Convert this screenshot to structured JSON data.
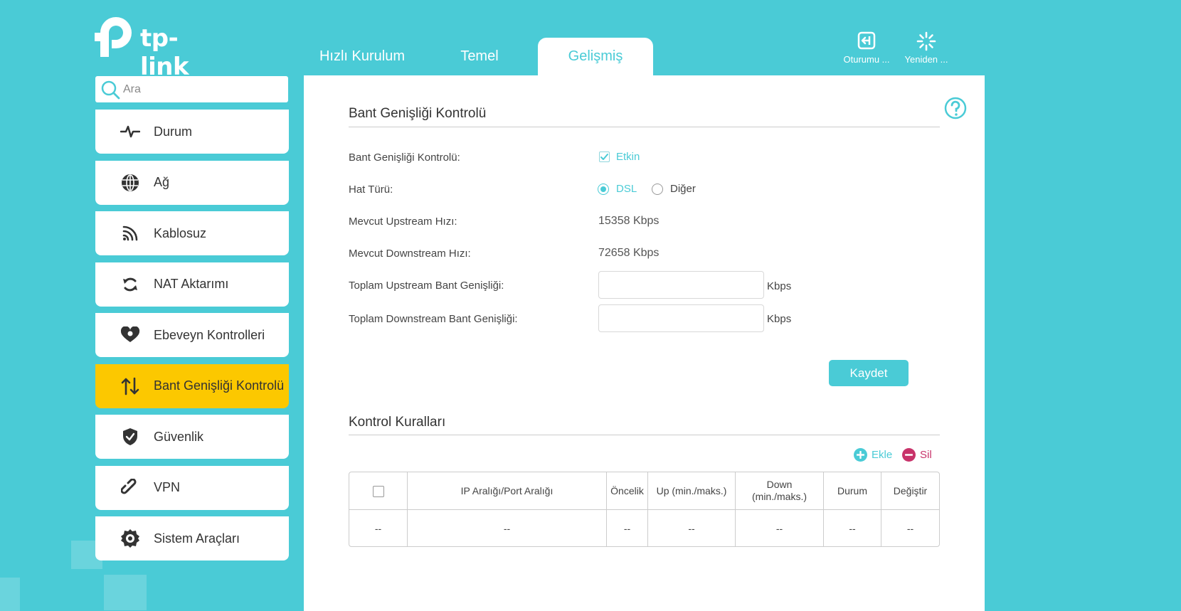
{
  "brand": {
    "name": "tp-link"
  },
  "tabs": [
    {
      "label": "Hızlı Kurulum"
    },
    {
      "label": "Temel"
    },
    {
      "label": "Gelişmiş"
    }
  ],
  "top_actions": {
    "logout": "Oturumu ...",
    "reboot": "Yeniden ..."
  },
  "search": {
    "placeholder": "Ara"
  },
  "sidebar": {
    "items": [
      {
        "label": "Durum",
        "icon": "pulse-icon"
      },
      {
        "label": "Ağ",
        "icon": "globe-icon"
      },
      {
        "label": "Kablosuz",
        "icon": "wireless-icon"
      },
      {
        "label": "NAT Aktarımı",
        "icon": "nat-icon"
      },
      {
        "label": "Ebeveyn Kontrolleri",
        "icon": "heart-icon"
      },
      {
        "label": "Bant Genişliği Kontrolü",
        "icon": "updown-arrows-icon"
      },
      {
        "label": "Güvenlik",
        "icon": "shield-icon"
      },
      {
        "label": "VPN",
        "icon": "link-icon"
      },
      {
        "label": "Sistem Araçları",
        "icon": "gear-icon"
      }
    ]
  },
  "bandwidth": {
    "title": "Bant Genişliği Kontrolü",
    "enable_label": "Bant Genişliği Kontrolü:",
    "enable_text": "Etkin",
    "line_type_label": "Hat Türü:",
    "line_dsl": "DSL",
    "line_other": "Diğer",
    "upstream_label": "Mevcut Upstream Hızı:",
    "upstream_value": "15358 Kbps",
    "downstream_label": "Mevcut Downstream Hızı:",
    "downstream_value": "72658 Kbps",
    "total_up_label": "Toplam Upstream Bant Genişliği:",
    "total_up_value": "",
    "total_down_label": "Toplam Downstream Bant Genişliği:",
    "total_down_value": "",
    "unit": "Kbps",
    "save": "Kaydet"
  },
  "rules": {
    "title": "Kontrol Kuralları",
    "add": "Ekle",
    "delete": "Sil",
    "columns": [
      "IP Aralığı/Port Aralığı",
      "Öncelik",
      "Up (min./maks.)",
      "Down (min./maks.)",
      "Durum",
      "Değiştir"
    ],
    "row": [
      "--",
      "--",
      "--",
      "--",
      "--",
      "--",
      "--"
    ]
  },
  "colors": {
    "accent": "#4acbd6",
    "active": "#fcc800",
    "delete": "#c8336a"
  }
}
